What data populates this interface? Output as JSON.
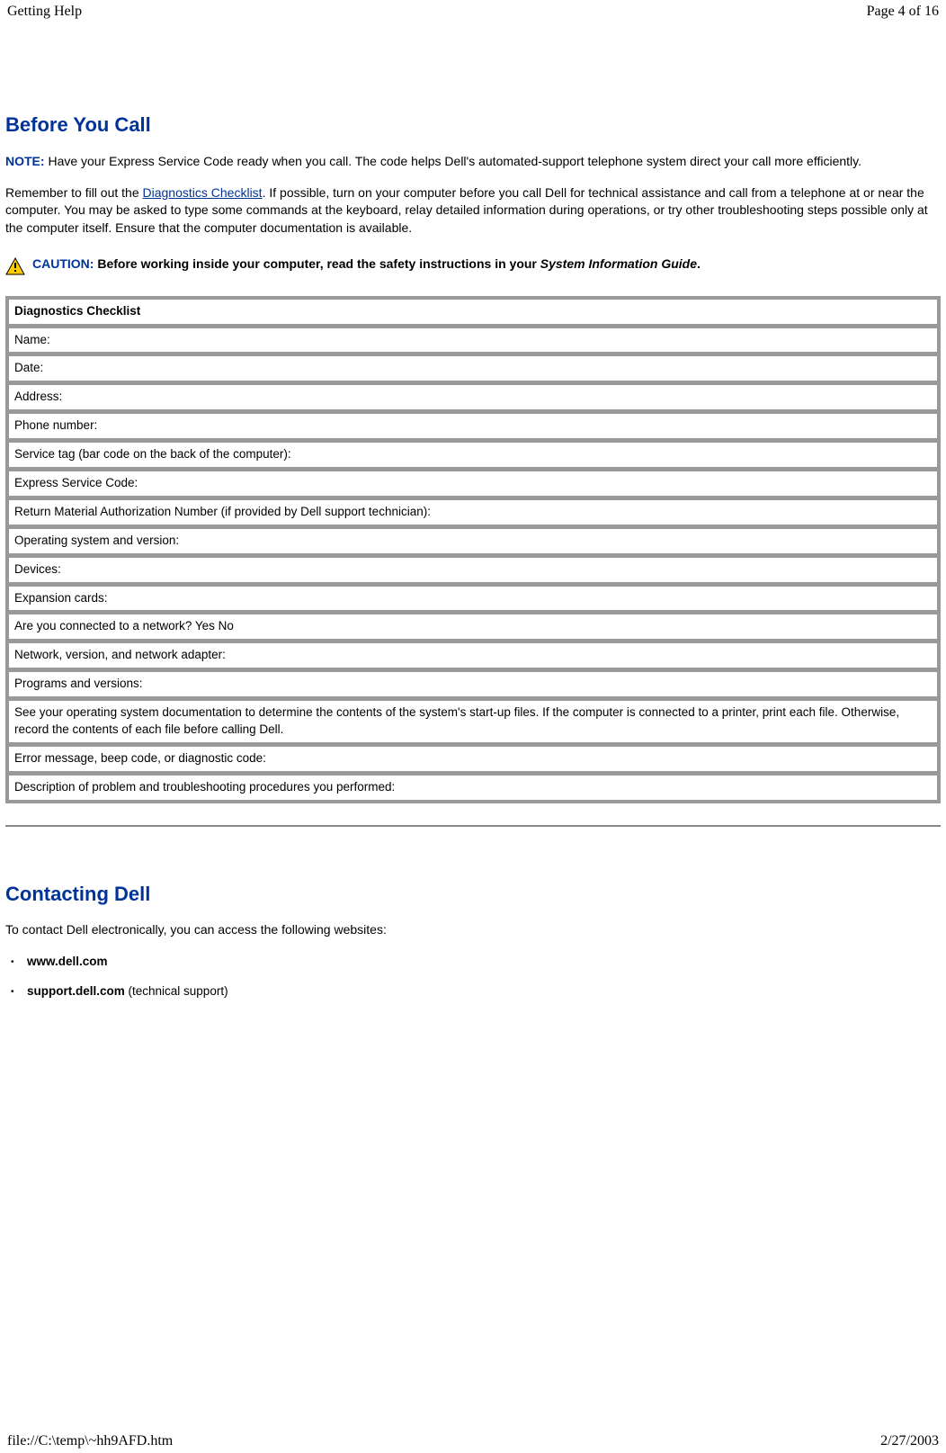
{
  "header": {
    "title": "Getting Help",
    "page_indicator": "Page 4 of 16"
  },
  "section1": {
    "heading": "Before You Call",
    "note_label": "NOTE:",
    "note_text": " Have your Express Service Code ready when you call. The code helps Dell's automated-support telephone system direct your call more efficiently.",
    "para_pre_link": "Remember to fill out the ",
    "para_link": "Diagnostics Checklist",
    "para_post_link": ". If possible, turn on your computer before you call Dell for technical assistance and call from a telephone at or near the computer. You may be asked to type some commands at the keyboard, relay detailed information during operations, or try other troubleshooting steps possible only at the computer itself. Ensure that the computer documentation is available.",
    "caution_label": "CAUTION: ",
    "caution_pre_italic": "Before working inside your computer, read the safety instructions in your ",
    "caution_italic": "System Information Guide",
    "caution_post_italic": "."
  },
  "checklist": {
    "title": "Diagnostics Checklist",
    "rows": [
      "Name:",
      "Date:",
      "Address:",
      "Phone number:",
      "Service tag (bar code on the back of the computer):",
      "Express Service Code:",
      "Return Material Authorization Number (if provided by Dell support technician):",
      "Operating system and version:",
      "Devices:",
      "Expansion cards:",
      "Are you connected to a network? Yes No",
      "Network, version, and network adapter:",
      "Programs and versions:",
      "See your operating system documentation to determine the contents of the system's start-up files. If the computer is connected to a printer, print each file. Otherwise, record the contents of each file before calling Dell.",
      "Error message, beep code, or diagnostic code:",
      "Description of problem and troubleshooting procedures you performed:"
    ]
  },
  "section2": {
    "heading": "Contacting Dell",
    "intro": "To contact Dell electronically, you can access the following websites:",
    "sites": [
      {
        "name": "www.dell.com",
        "suffix": ""
      },
      {
        "name": "support.dell.com",
        "suffix": " (technical support)"
      }
    ]
  },
  "footer": {
    "path": "file://C:\\temp\\~hh9AFD.htm",
    "date": "2/27/2003"
  }
}
